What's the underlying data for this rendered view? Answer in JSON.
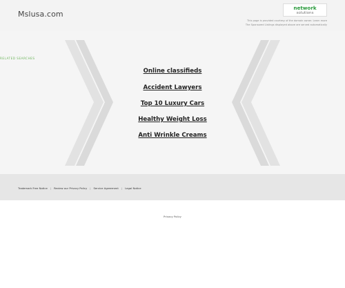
{
  "header": {
    "site_title": "Mslusa.com",
    "logo_line1": "network",
    "logo_line2": "solutions",
    "note_line1": "This page is provided courtesy of the domain owner. Learn more",
    "note_line2": "The Sponsored Listings displayed above are served automatically"
  },
  "main": {
    "related_title": "RELATED SEARCHES",
    "links": [
      "Online classifieds",
      "Accident Lawyers",
      "Top 10 Luxury Cars",
      "Healthy Weight Loss",
      "Anti Wrinkle Creams"
    ]
  },
  "footer": {
    "links": [
      "Trademark Free Notice",
      "Review our Privacy Policy",
      "Service Agreement",
      "Legal Notice"
    ],
    "privacy": "Privacy Policy"
  },
  "colors": {
    "accent_green": "#6cb45a",
    "header_bg": "#f3f3f3",
    "footer_bg": "#e6e6e6"
  }
}
